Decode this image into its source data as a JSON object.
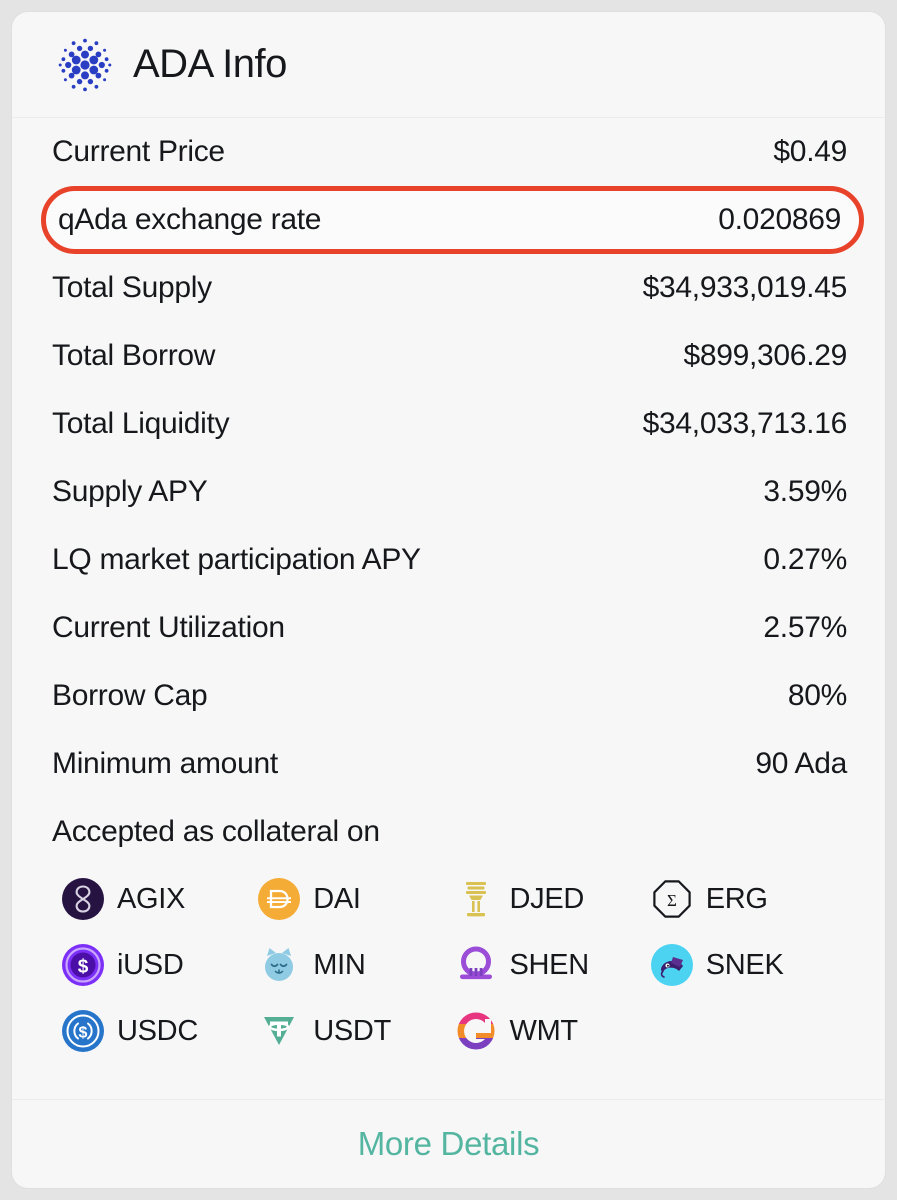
{
  "header": {
    "title": "ADA Info",
    "logo_icon": "cardano-logo-icon",
    "logo_color": "#2a3ec4"
  },
  "stats": [
    {
      "label": "Current Price",
      "value": "$0.49",
      "highlighted": false
    },
    {
      "label": "qAda exchange rate",
      "value": "0.020869",
      "highlighted": true
    },
    {
      "label": "Total Supply",
      "value": "$34,933,019.45",
      "highlighted": false
    },
    {
      "label": "Total Borrow",
      "value": "$899,306.29",
      "highlighted": false
    },
    {
      "label": "Total Liquidity",
      "value": "$34,033,713.16",
      "highlighted": false
    },
    {
      "label": "Supply APY",
      "value": "3.59%",
      "highlighted": false
    },
    {
      "label": "LQ market participation APY",
      "value": "0.27%",
      "highlighted": false
    },
    {
      "label": "Current Utilization",
      "value": "2.57%",
      "highlighted": false
    },
    {
      "label": "Borrow Cap",
      "value": "80%",
      "highlighted": false
    },
    {
      "label": "Minimum amount",
      "value": "90 Ada",
      "highlighted": false
    }
  ],
  "collateral": {
    "title": "Accepted as collateral on",
    "tokens": [
      {
        "name": "AGIX",
        "icon": "agix-token-icon"
      },
      {
        "name": "DAI",
        "icon": "dai-token-icon"
      },
      {
        "name": "DJED",
        "icon": "djed-token-icon"
      },
      {
        "name": "ERG",
        "icon": "erg-token-icon"
      },
      {
        "name": "iUSD",
        "icon": "iusd-token-icon"
      },
      {
        "name": "MIN",
        "icon": "min-token-icon"
      },
      {
        "name": "SHEN",
        "icon": "shen-token-icon"
      },
      {
        "name": "SNEK",
        "icon": "snek-token-icon"
      },
      {
        "name": "USDC",
        "icon": "usdc-token-icon"
      },
      {
        "name": "USDT",
        "icon": "usdt-token-icon"
      },
      {
        "name": "WMT",
        "icon": "wmt-token-icon"
      }
    ]
  },
  "footer": {
    "more_details_label": "More Details"
  },
  "annotation": {
    "highlight_color": "#e8432a",
    "target_label": "qAda exchange rate"
  },
  "colors": {
    "page_background": "#e4e4e4",
    "card_background": "#f7f7f8",
    "text": "#16181c",
    "link": "#54b5a0"
  }
}
